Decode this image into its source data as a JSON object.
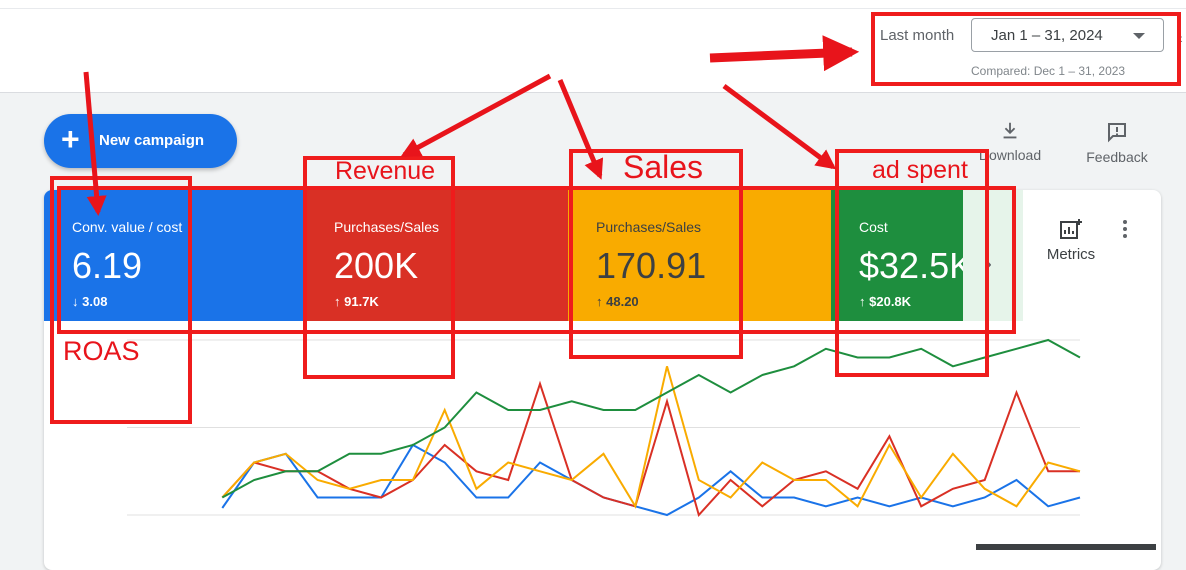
{
  "header": {
    "period_label": "Last month",
    "date_range": "Jan 1 – 31, 2024",
    "compared": "Compared: Dec 1 – 31, 2023"
  },
  "toolbar": {
    "new_campaign": "New campaign",
    "download": "Download",
    "feedback": "Feedback",
    "metrics": "Metrics"
  },
  "tiles": [
    {
      "label": "Conv. value / cost",
      "value": "6.19",
      "delta": "3.08",
      "direction": "down",
      "color": "#1a73e8"
    },
    {
      "label": "Purchases/Sales",
      "value": "200K",
      "delta": "91.7K",
      "direction": "up",
      "color": "#d93025"
    },
    {
      "label": "Purchases/Sales",
      "value": "170.91",
      "delta": "48.20",
      "direction": "up",
      "color": "#f9ab00"
    },
    {
      "label": "Cost",
      "value": "$32.5K",
      "delta": "$20.8K",
      "direction": "up",
      "color": "#1e8e3e"
    }
  ],
  "annotations": {
    "roas": "ROAS",
    "revenue": "Revenue",
    "sales": "Sales",
    "ad_spent": "ad spent"
  },
  "colors": {
    "blue": "#1a73e8",
    "red": "#d93025",
    "yellow": "#f9ab00",
    "green": "#1e8e3e",
    "annotation": "#ef1c1c"
  },
  "chart_data": {
    "type": "line",
    "grid": true,
    "ylim": [
      0,
      100
    ],
    "x": [
      1,
      2,
      3,
      4,
      5,
      6,
      7,
      8,
      9,
      10,
      11,
      12,
      13,
      14,
      15,
      16,
      17,
      18,
      19,
      20,
      21,
      22,
      23,
      24,
      25,
      26,
      27,
      28,
      29,
      30,
      31
    ],
    "series": [
      {
        "color": "#1a73e8",
        "style": "solid",
        "values": [
          null,
          null,
          null,
          4,
          30,
          35,
          10,
          10,
          10,
          40,
          30,
          10,
          10,
          30,
          20,
          10,
          5,
          0,
          10,
          25,
          10,
          10,
          5,
          10,
          5,
          10,
          5,
          10,
          20,
          5,
          10,
          10,
          15
        ]
      },
      {
        "color": "#d93025",
        "style": "solid",
        "values": [
          null,
          null,
          null,
          10,
          30,
          25,
          25,
          15,
          10,
          20,
          40,
          25,
          20,
          75,
          20,
          10,
          5,
          65,
          0,
          20,
          5,
          20,
          25,
          15,
          45,
          5,
          15,
          20,
          70,
          25,
          25,
          40
        ]
      },
      {
        "color": "#f9ab00",
        "style": "solid",
        "values": [
          null,
          null,
          null,
          10,
          30,
          35,
          20,
          15,
          20,
          20,
          60,
          15,
          30,
          25,
          20,
          35,
          5,
          85,
          20,
          10,
          30,
          20,
          20,
          5,
          40,
          10,
          35,
          15,
          5,
          30,
          25,
          10
        ]
      },
      {
        "color": "#1e8e3e",
        "style": "solid",
        "values": [
          null,
          null,
          null,
          10,
          20,
          25,
          25,
          35,
          35,
          40,
          50,
          70,
          60,
          60,
          65,
          60,
          60,
          70,
          80,
          70,
          80,
          85,
          95,
          90,
          90,
          95,
          85,
          90,
          95,
          100,
          90,
          100,
          100
        ]
      }
    ]
  }
}
